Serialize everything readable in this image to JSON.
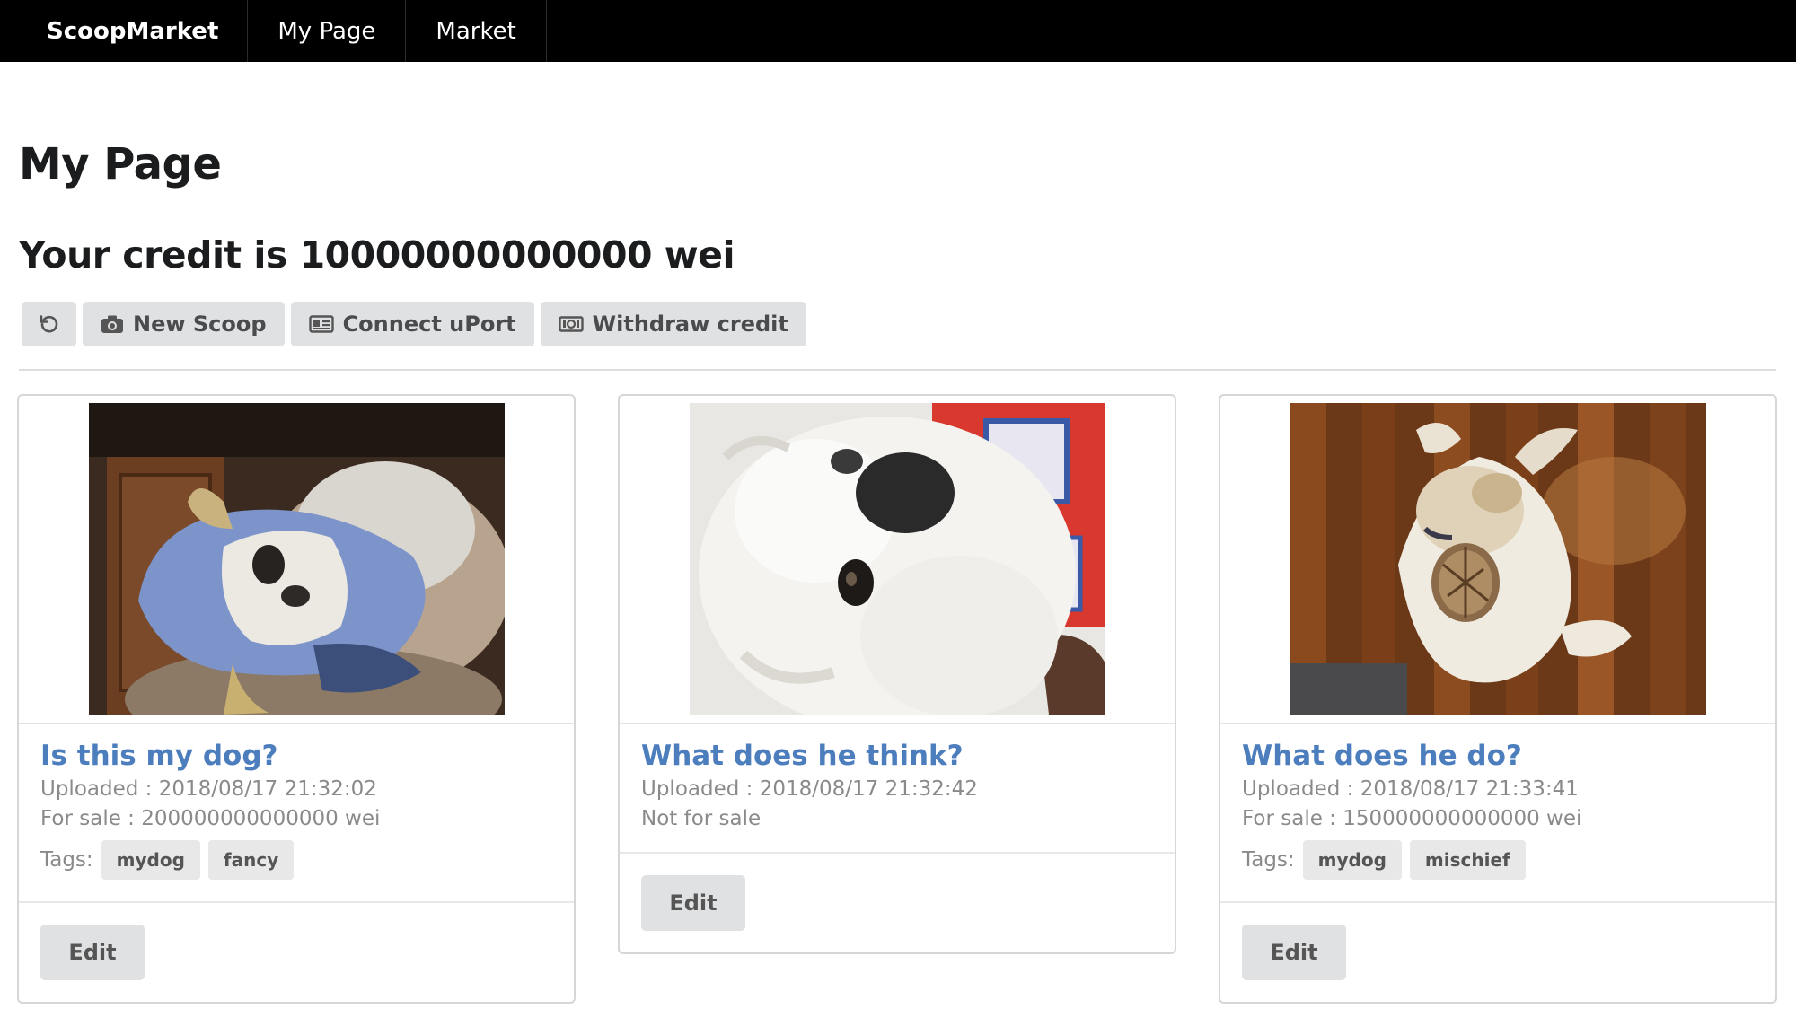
{
  "nav": {
    "brand": "ScoopMarket",
    "items": [
      "My Page",
      "Market"
    ]
  },
  "page": {
    "title": "My Page",
    "credit": "Your credit is 10000000000000 wei"
  },
  "toolbar": {
    "refresh_icon": "refresh-icon",
    "new_scoop": "New Scoop",
    "new_scoop_icon": "camera-icon",
    "connect_uport": "Connect uPort",
    "connect_uport_icon": "id-card-icon",
    "withdraw": "Withdraw credit",
    "withdraw_icon": "money-bill-icon"
  },
  "tags_label": "Tags:",
  "edit_label": "Edit",
  "colors": {
    "navbar": "#000000",
    "link": "#4c7dbd",
    "button": "#e0e1e2"
  },
  "cards": [
    {
      "title": "Is this my dog?",
      "uploaded": "Uploaded : 2018/08/17 21:32:02",
      "sale": "For sale : 200000000000000 wei",
      "tags": [
        "mydog",
        "fancy"
      ]
    },
    {
      "title": "What does he think?",
      "uploaded": "Uploaded : 2018/08/17 21:32:42",
      "sale": "Not for sale",
      "tags": []
    },
    {
      "title": "What does he do?",
      "uploaded": "Uploaded : 2018/08/17 21:33:41",
      "sale": "For sale : 150000000000000 wei",
      "tags": [
        "mydog",
        "mischief"
      ]
    }
  ]
}
